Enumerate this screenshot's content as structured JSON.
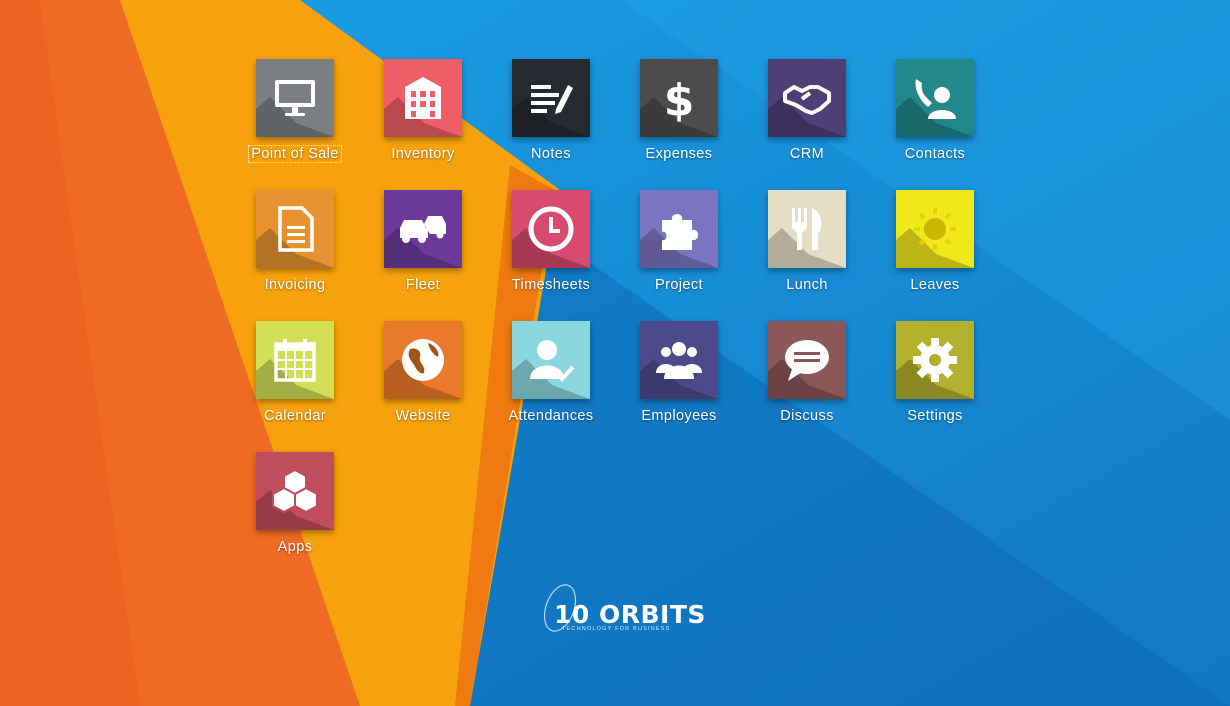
{
  "apps": [
    {
      "label": "Point of Sale",
      "icon": "monitor-icon",
      "color": "#7b7f83",
      "focused": true
    },
    {
      "label": "Inventory",
      "icon": "building-icon",
      "color": "#ef5d66"
    },
    {
      "label": "Notes",
      "icon": "notes-pencil-icon",
      "color": "#262b33"
    },
    {
      "label": "Expenses",
      "icon": "dollar-icon",
      "color": "#4c4c4c"
    },
    {
      "label": "CRM",
      "icon": "handshake-icon",
      "color": "#4e3f77"
    },
    {
      "label": "Contacts",
      "icon": "contacts-phone-icon",
      "color": "#21878a"
    },
    {
      "label": "Invoicing",
      "icon": "document-icon",
      "color": "#e69230"
    },
    {
      "label": "Fleet",
      "icon": "cars-icon",
      "color": "#6b3a9a"
    },
    {
      "label": "Timesheets",
      "icon": "clock-icon",
      "color": "#d84a6e"
    },
    {
      "label": "Project",
      "icon": "puzzle-icon",
      "color": "#7b74c0"
    },
    {
      "label": "Lunch",
      "icon": "fork-knife-icon",
      "color": "#e5ddc4"
    },
    {
      "label": "Leaves",
      "icon": "sun-icon",
      "color": "#f0e81b"
    },
    {
      "label": "Calendar",
      "icon": "calendar-icon",
      "color": "#d2de55"
    },
    {
      "label": "Website",
      "icon": "globe-icon",
      "color": "#ea7a2b"
    },
    {
      "label": "Attendances",
      "icon": "user-check-icon",
      "color": "#8ad7de"
    },
    {
      "label": "Employees",
      "icon": "people-icon",
      "color": "#4d4a8c"
    },
    {
      "label": "Discuss",
      "icon": "chat-bubble-icon",
      "color": "#8b5758"
    },
    {
      "label": "Settings",
      "icon": "gear-icon",
      "color": "#b3b02c"
    },
    {
      "label": "Apps",
      "icon": "cubes-icon",
      "color": "#c04d5b"
    }
  ],
  "branding": {
    "logo_text": "10 ORBITS",
    "logo_tagline": "TECHNOLOGY FOR BUSINESS"
  },
  "colors": {
    "background_blue": "#1496df",
    "background_orange": "#f06b23",
    "background_amber": "#f7a20c"
  }
}
